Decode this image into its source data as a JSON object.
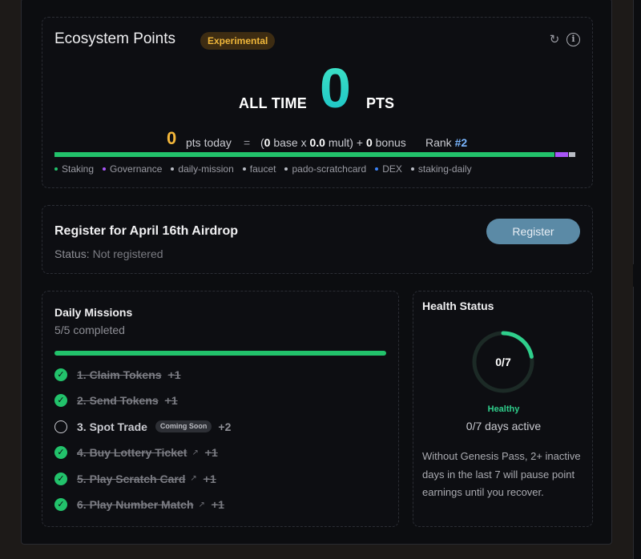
{
  "ecosystem": {
    "title": "Ecosystem Points",
    "badge": "Experimental",
    "all_time_label": "ALL TIME",
    "all_time_value": "0",
    "pts_label": "PTS",
    "today_value": "0",
    "today_label": "pts today",
    "equals": "=",
    "formula_open": "(",
    "base_value": "0",
    "base_label": "base x",
    "mult_value": "0.0",
    "mult_label": "mult) +",
    "bonus_value": "0",
    "bonus_label": "bonus",
    "rank_label": "Rank",
    "rank_value": "#2",
    "bar_segments": [
      {
        "name": "Staking",
        "fraction": 0.955,
        "color": "#22c26b"
      },
      {
        "name": "Governance",
        "fraction": 0.025,
        "color": "#a855f7"
      },
      {
        "name": "other",
        "fraction": 0.012,
        "color": "#b9bcc4"
      }
    ],
    "legend": [
      {
        "label": "Staking",
        "color": "#22c26b"
      },
      {
        "label": "Governance",
        "color": "#a855f7"
      },
      {
        "label": "daily-mission",
        "color": "#b9bcc4"
      },
      {
        "label": "faucet",
        "color": "#b9bcc4"
      },
      {
        "label": "pado-scratchcard",
        "color": "#b9bcc4"
      },
      {
        "label": "DEX",
        "color": "#3b82f6"
      },
      {
        "label": "staking-daily",
        "color": "#b9bcc4"
      }
    ]
  },
  "register": {
    "title": "Register for April 16th Airdrop",
    "status_label": "Status:",
    "status_value": "Not registered",
    "button_label": "Register"
  },
  "missions": {
    "title": "Daily Missions",
    "subtitle": "5/5 completed",
    "progress": 1.0,
    "items": [
      {
        "label": "1. Claim Tokens",
        "points": "+1",
        "done": true,
        "external": false
      },
      {
        "label": "2. Send Tokens",
        "points": "+1",
        "done": true,
        "external": false
      },
      {
        "label": "3. Spot Trade",
        "points": "+2",
        "done": false,
        "external": false,
        "tag": "Coming Soon"
      },
      {
        "label": "4. Buy Lottery Ticket",
        "points": "+1",
        "done": true,
        "external": true
      },
      {
        "label": "5. Play Scratch Card",
        "points": "+1",
        "done": true,
        "external": true
      },
      {
        "label": "6. Play Number Match",
        "points": "+1",
        "done": true,
        "external": true
      }
    ]
  },
  "health": {
    "title": "Health Status",
    "ring_label": "0/7",
    "ring_fraction": 0.22,
    "state": "Healthy",
    "days": "0/7 days active",
    "note": "Without Genesis Pass, 2+ inactive days in the last 7 will pause point earnings until you recover."
  },
  "icons": {
    "refresh": "refresh-icon",
    "info": "info-icon",
    "check": "check-circle-icon",
    "external": "external-link-icon"
  }
}
